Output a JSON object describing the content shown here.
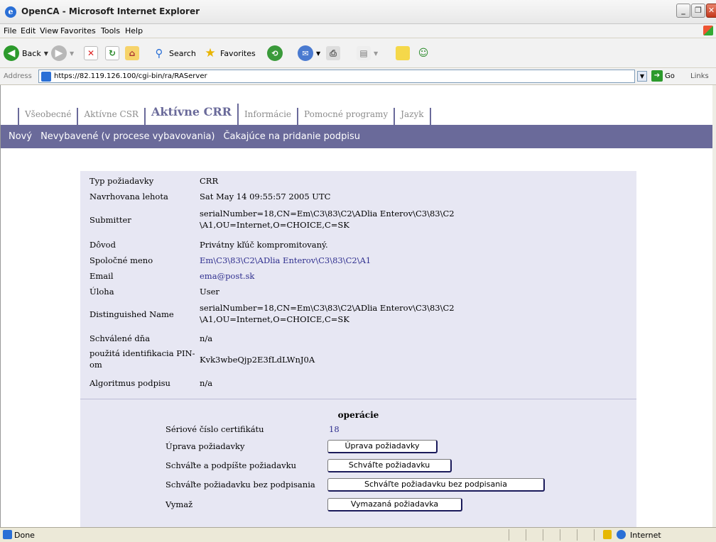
{
  "window": {
    "title": "OpenCA - Microsoft Internet Explorer"
  },
  "menu": [
    "File",
    "Edit",
    "View",
    "Favorites",
    "Tools",
    "Help"
  ],
  "toolbar": {
    "back": "Back",
    "search": "Search",
    "favorites": "Favorites"
  },
  "address": {
    "label": "Address",
    "url": "https://82.119.126.100/cgi-bin/ra/RAServer",
    "go": "Go",
    "links": "Links"
  },
  "tabs": [
    "Všeobecné",
    "Aktívne CSR",
    "Aktívne CRR",
    "Informácie",
    "Pomocné programy",
    "Jazyk"
  ],
  "active_tab": "Aktívne CRR",
  "subnav": [
    "Nový",
    "Nevybavené (v procese vybavovania)",
    "Čakajúce na pridanie podpisu"
  ],
  "details": [
    {
      "key": "Typ požiadavky",
      "value": "CRR"
    },
    {
      "key": "Navrhovana lehota",
      "value": "Sat May 14 09:55:57 2005 UTC"
    },
    {
      "key": "Submitter",
      "value": "serialNumber=18,CN=Em\\C3\\83\\C2\\ADlia Enterov\\C3\\83\\C2\n\\A1,OU=Internet,O=CHOICE,C=SK"
    },
    {
      "key": "Dôvod",
      "value": "Privátny kľúč kompromitovaný."
    },
    {
      "key": "Spoločné meno",
      "value": "Em\\C3\\83\\C2\\ADlia Enterov\\C3\\83\\C2\\A1"
    },
    {
      "key": "Email",
      "value": "ema@post.sk"
    },
    {
      "key": "Úloha",
      "value": "User"
    },
    {
      "key": "Distinguished Name",
      "value": "serialNumber=18,CN=Em\\C3\\83\\C2\\ADlia Enterov\\C3\\83\\C2\n\\A1,OU=Internet,O=CHOICE,C=SK"
    },
    {
      "key": "Schválené dňa",
      "value": "n/a"
    },
    {
      "key": "použitá identifikacia PIN-\nom",
      "value": "Kvk3wbeQjp2E3fLdLWnJ0A"
    },
    {
      "key": "Algoritmus podpisu",
      "value": "n/a"
    }
  ],
  "operations": {
    "title": "operácie",
    "serial_label": "Sériové číslo certifikátu",
    "serial_value": "18",
    "edit_label": "Úprava požiadavky",
    "edit_button": "Úprava požiadavky",
    "approve_sign_label": "Schváľte a podpíšte požiadavku",
    "approve_sign_button": "Schváľte požiadavku",
    "approve_nosign_label": "Schváľte požiadavku bez podpisania",
    "approve_nosign_button": "Schváľte požiadavku bez podpisania",
    "delete_label": "Vymaž",
    "delete_button": "Vymazaná požiadavka"
  },
  "status": {
    "text": "Done",
    "zone": "Internet"
  }
}
